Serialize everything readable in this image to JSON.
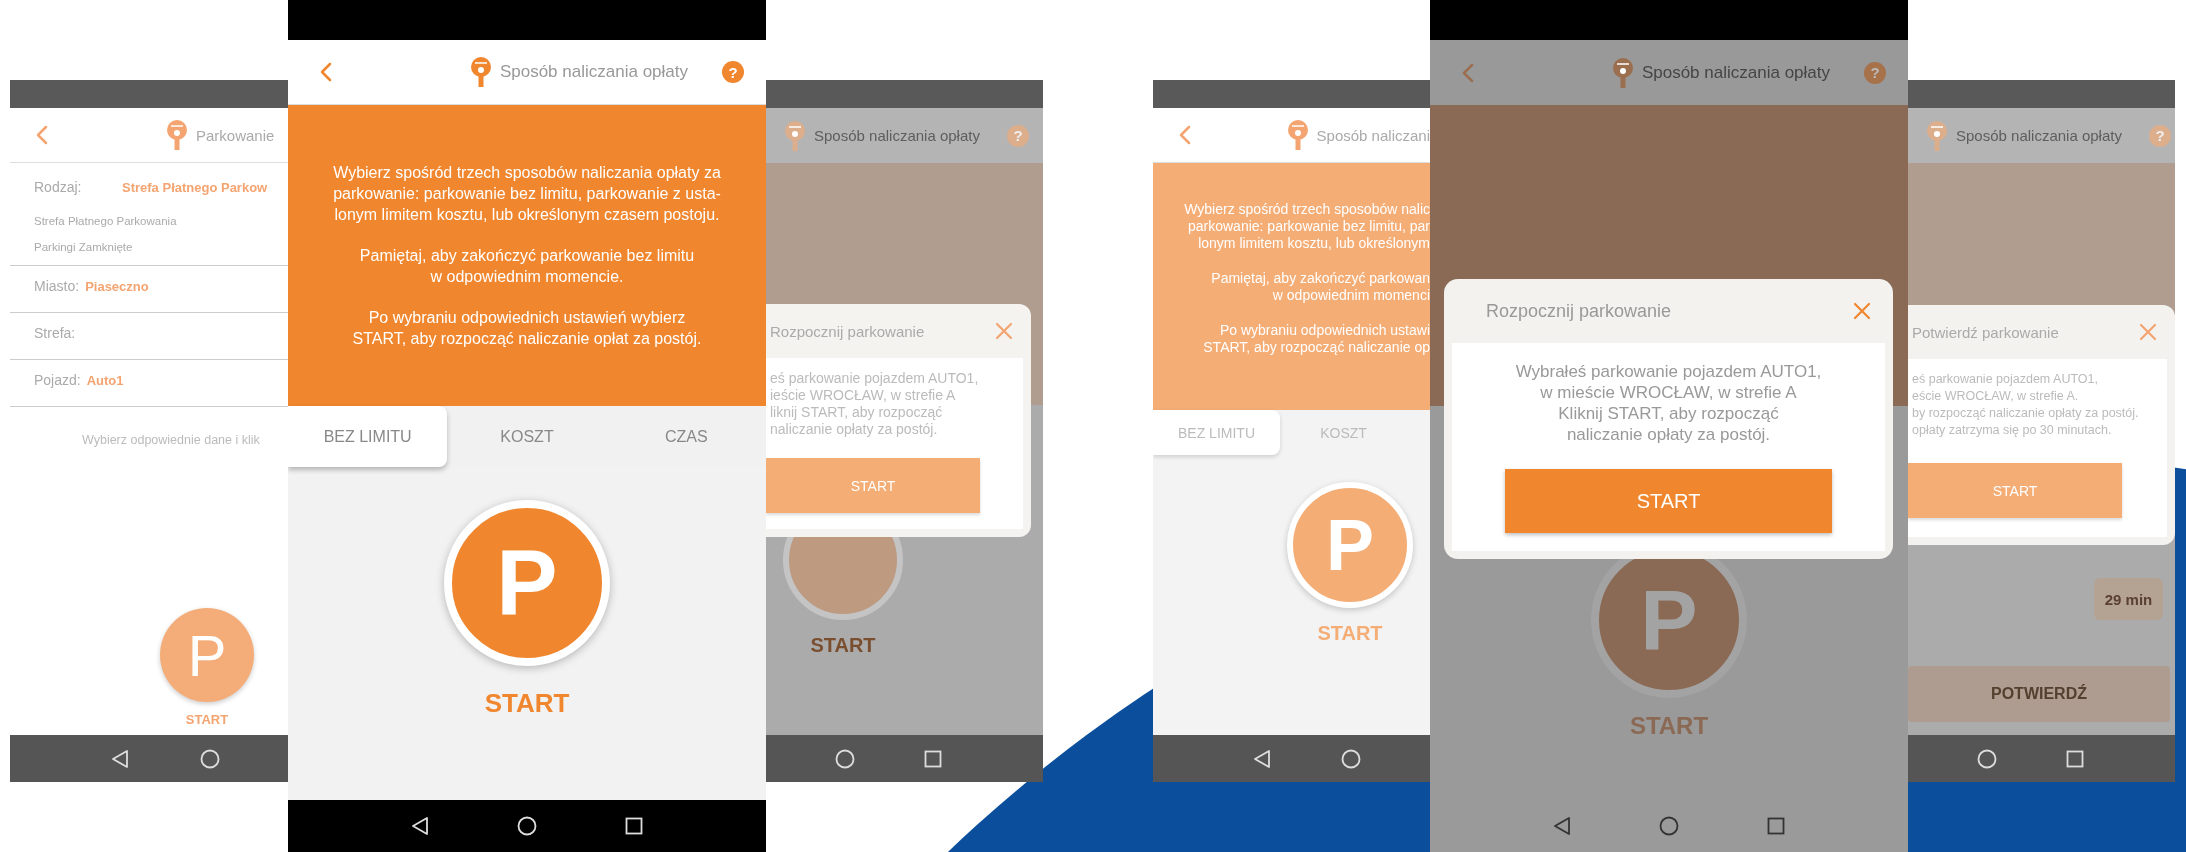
{
  "screens": [
    {
      "kind": "parking_form",
      "title": "Parkowanie",
      "fields": [
        {
          "label": "Rodzaj:",
          "value": "Strefa Płatnego Parkow",
          "options": [
            "Strefa Płatnego Parkowania",
            "Parkingi Zamknięte"
          ]
        },
        {
          "label": "Miasto:",
          "value": "Piaseczno"
        },
        {
          "label": "Strefa:"
        },
        {
          "label": "Pojazd:",
          "value": "Auto1"
        }
      ],
      "hint": "Wybierz odpowiednie dane i klik",
      "button_glyph": "P",
      "button_label": "START"
    },
    {
      "kind": "method_select",
      "title": "Sposób naliczania opłaty",
      "help": "?",
      "info": [
        "Wybierz spośród trzech sposobów naliczania opłaty za\nparkowanie: parkowanie bez limitu, parkowanie z usta-\nlonym limitem kosztu, lub określonym czasem postoju.",
        "Pamiętaj, aby zakończyć parkowanie bez limitu\nw odpowiednim momencie.",
        "Po wybraniu odpowiednich ustawień wybierz\nSTART, aby rozpocząć naliczanie opłat za postój."
      ],
      "tabs": [
        {
          "label": "BEZ LIMITU",
          "selected": true
        },
        {
          "label": "KOSZT",
          "selected": false
        },
        {
          "label": "CZAS",
          "selected": false
        }
      ],
      "button_glyph": "P",
      "button_label": "START"
    },
    {
      "kind": "dialog_peek",
      "title": "Sposób naliczania opłaty",
      "help": "?",
      "dialog": {
        "title": "Rozpocznij parkowanie",
        "text": "eś parkowanie pojazdem AUTO1,\nieście WROCŁAW, w strefie A\nliknij START, aby rozpocząć\nnaliczanie opłaty za postój.",
        "button": "START"
      },
      "button_label": "START"
    },
    {
      "kind": "method_peek",
      "title": "Sposób naliczani",
      "info": [
        "Wybierz spośród trzech sposobów nalic\nparkowanie: parkowanie bez limitu, par\nlonym limitem kosztu, lub określonym",
        "Pamiętaj, aby zakończyć parkowan\nw odpowiednim momenci",
        "Po wybraniu odpowiednich ustawi\nSTART, aby rozpocząć naliczanie op"
      ],
      "tabs": [
        {
          "label": "BEZ LIMITU",
          "selected": true
        },
        {
          "label": "KOSZT",
          "selected": false
        }
      ],
      "button_glyph": "P",
      "button_label": "START"
    },
    {
      "kind": "start_dialog",
      "title": "Sposób naliczania opłaty",
      "help": "?",
      "dialog": {
        "title": "Rozpocznij parkowanie",
        "text": "Wybrałeś parkowanie pojazdem AUTO1,\nw mieście WROCŁAW, w strefie A\nKliknij START, aby rozpocząć\nnaliczanie opłaty za postój.",
        "button": "START"
      },
      "button_glyph": "P",
      "button_label": "START"
    },
    {
      "kind": "confirm_peek",
      "title": "Sposób naliczania opłaty",
      "help": "?",
      "dialog": {
        "title": "Potwierdź parkowanie",
        "text": "eś parkowanie pojazdem AUTO1,\neście WROCŁAW, w strefie A.\nby rozpocząć naliczanie opłaty za postój.\nopłaty zatrzyma się po 30 minutach.",
        "button": "START"
      },
      "duration": "29 min",
      "confirm": "POTWIERDŹ"
    }
  ]
}
